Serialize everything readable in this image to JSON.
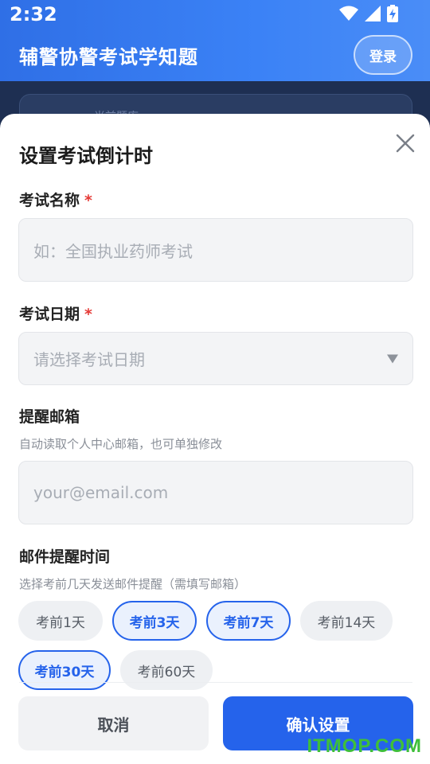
{
  "status_bar": {
    "time": "2:32"
  },
  "header": {
    "app_title": "辅警协警考试学知题",
    "login_label": "登录"
  },
  "background": {
    "card_text": "当前题库"
  },
  "sheet": {
    "title": "设置考试倒计时",
    "exam_name": {
      "label": "考试名称",
      "required_mark": "*",
      "placeholder": "如：全国执业药师考试"
    },
    "exam_date": {
      "label": "考试日期",
      "required_mark": "*",
      "placeholder": "请选择考试日期"
    },
    "email": {
      "label": "提醒邮箱",
      "hint": "自动读取个人中心邮箱，也可单独修改",
      "placeholder": "your@email.com"
    },
    "reminder": {
      "label": "邮件提醒时间",
      "hint": "选择考前几天发送邮件提醒（需填写邮箱）",
      "options": [
        {
          "label": "考前1天",
          "selected": false
        },
        {
          "label": "考前3天",
          "selected": true
        },
        {
          "label": "考前7天",
          "selected": true
        },
        {
          "label": "考前14天",
          "selected": false
        },
        {
          "label": "考前30天",
          "selected": true
        },
        {
          "label": "考前60天",
          "selected": false
        }
      ]
    },
    "cancel_label": "取消",
    "confirm_label": "确认设置"
  },
  "colors": {
    "accent": "#2563eb",
    "header": "#3b82f6",
    "required": "#e53935"
  },
  "watermark": "ITMOP.COM"
}
